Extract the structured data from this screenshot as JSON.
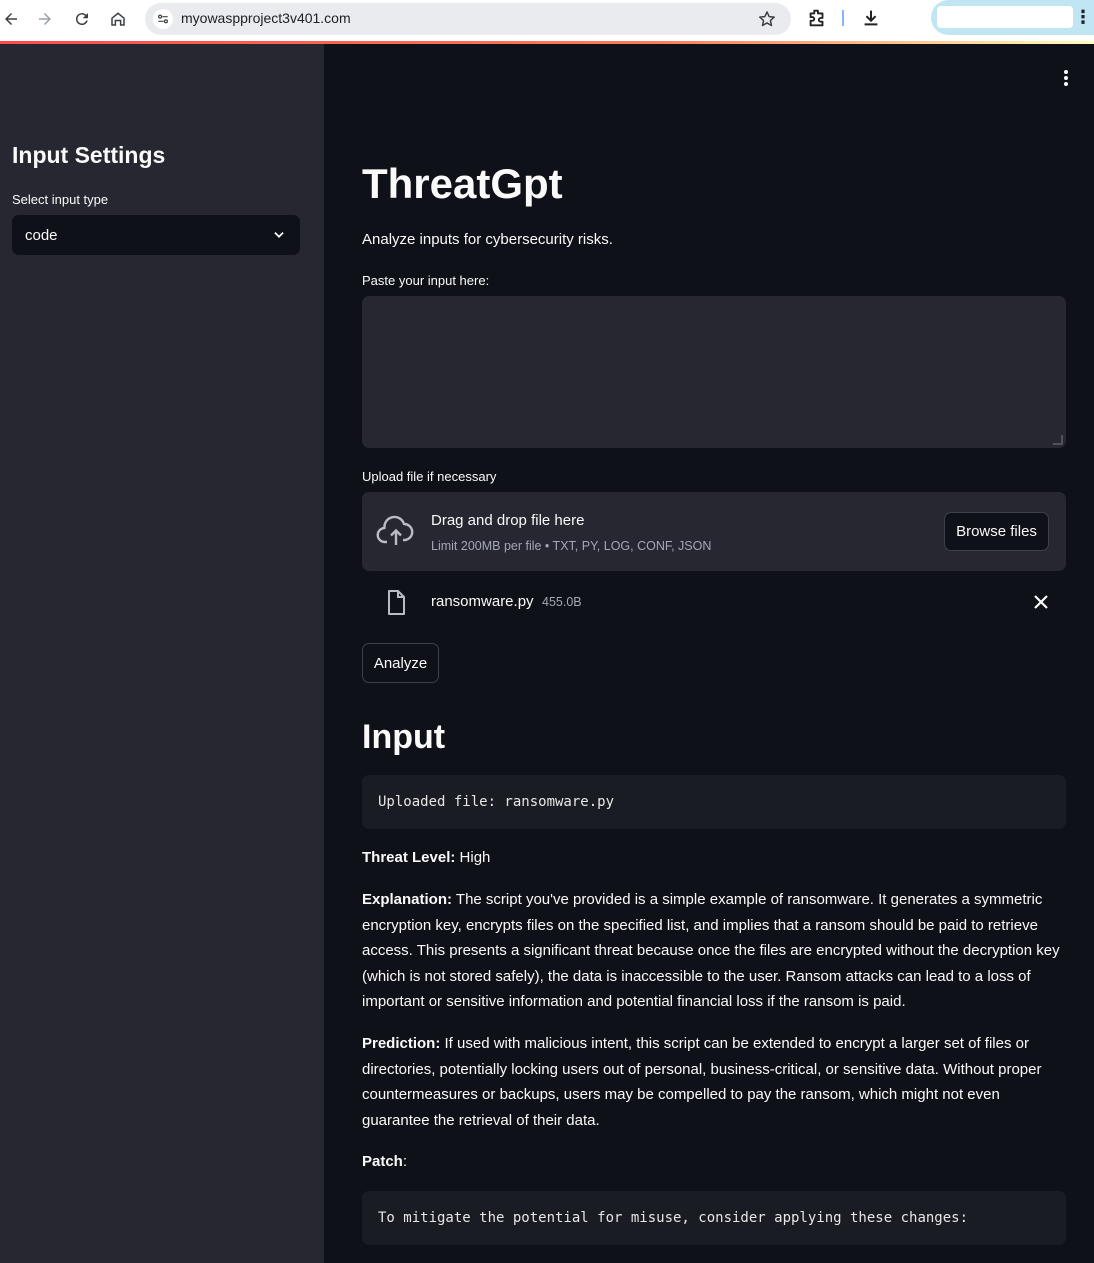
{
  "browser": {
    "url": "myowaspproject3v401.com"
  },
  "sidebar": {
    "heading": "Input Settings",
    "select_label": "Select input type",
    "select_value": "code"
  },
  "main": {
    "title": "ThreatGpt",
    "subtitle": "Analyze inputs for cybersecurity risks.",
    "textarea_label": "Paste your input here:",
    "textarea_value": "",
    "upload_label": "Upload file if necessary",
    "dropzone_title": "Drag and drop file here",
    "dropzone_limit": "Limit 200MB per file • TXT, PY, LOG, CONF, JSON",
    "browse_label": "Browse files",
    "file_name": "ransomware.py",
    "file_size": "455.0B",
    "analyze_label": "Analyze",
    "input_heading": "Input",
    "uploaded_code": "Uploaded file: ransomware.py",
    "threat_level_label": "Threat Level:",
    "threat_level_value": "High",
    "explanation_label": "Explanation:",
    "explanation_text": "The script you've provided is a simple example of ransomware. It generates a symmetric encryption key, encrypts files on the specified list, and implies that a ransom should be paid to retrieve access. This presents a significant threat because once the files are encrypted without the decryption key (which is not stored safely), the data is inaccessible to the user. Ransom attacks can lead to a loss of important or sensitive information and potential financial loss if the ransom is paid.",
    "prediction_label": "Prediction:",
    "prediction_text": "If used with malicious intent, this script can be extended to encrypt a larger set of files or directories, potentially locking users out of personal, business-critical, or sensitive data. Without proper countermeasures or backups, users may be compelled to pay the ransom, which might not even guarantee the retrieval of their data.",
    "patch_label": "Patch",
    "patch_colon": ":",
    "patch_code": "To mitigate the potential for misuse, consider applying these changes:"
  },
  "colors": {
    "accent": "#ff4b4b",
    "sidebar_bg": "#262730",
    "main_bg": "#0e1117"
  },
  "icons": [
    "back-icon",
    "forward-icon",
    "reload-icon",
    "home-icon",
    "site-info-icon",
    "star-icon",
    "extensions-icon",
    "download-icon",
    "menu-icon",
    "chevron-down-icon",
    "kebab-menu-icon",
    "cloud-upload-icon",
    "file-icon",
    "close-icon"
  ]
}
